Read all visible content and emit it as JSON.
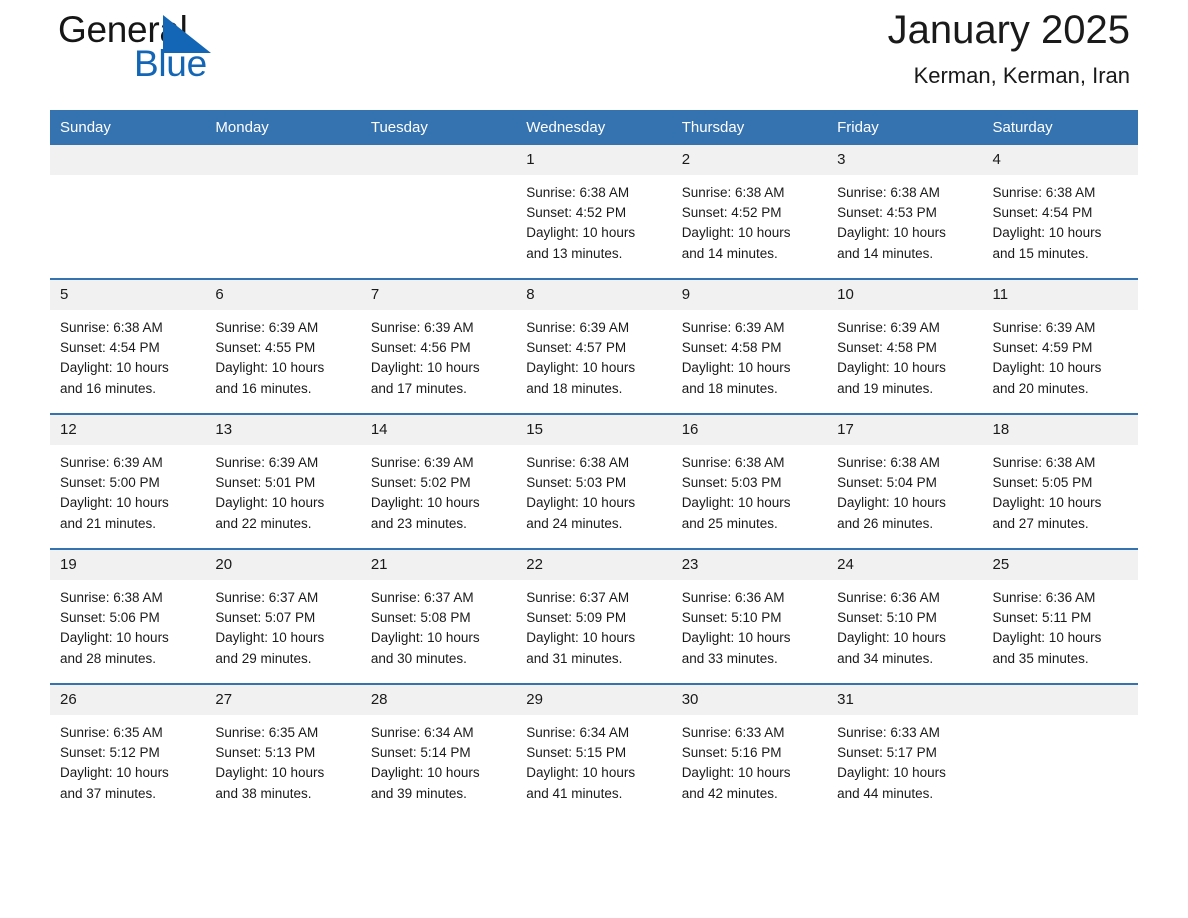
{
  "brand": {
    "word1": "General",
    "word2": "Blue",
    "triangle_color": "#1266b5",
    "word1_color": "#161616",
    "word2_color": "#1266b5"
  },
  "header": {
    "title": "January 2025",
    "subtitle": "Kerman, Kerman, Iran"
  },
  "colors": {
    "header_blue": "#3572b0",
    "row_divider_blue": "#3572b0",
    "daynum_band": "#f1f1f1",
    "text": "#1a1a1a"
  },
  "weekday_headers": [
    "Sunday",
    "Monday",
    "Tuesday",
    "Wednesday",
    "Thursday",
    "Friday",
    "Saturday"
  ],
  "weeks": [
    [
      {
        "day": "",
        "sunrise": "",
        "sunset": "",
        "daylight1": "",
        "daylight2": ""
      },
      {
        "day": "",
        "sunrise": "",
        "sunset": "",
        "daylight1": "",
        "daylight2": ""
      },
      {
        "day": "",
        "sunrise": "",
        "sunset": "",
        "daylight1": "",
        "daylight2": ""
      },
      {
        "day": "1",
        "sunrise": "Sunrise: 6:38 AM",
        "sunset": "Sunset: 4:52 PM",
        "daylight1": "Daylight: 10 hours",
        "daylight2": "and 13 minutes."
      },
      {
        "day": "2",
        "sunrise": "Sunrise: 6:38 AM",
        "sunset": "Sunset: 4:52 PM",
        "daylight1": "Daylight: 10 hours",
        "daylight2": "and 14 minutes."
      },
      {
        "day": "3",
        "sunrise": "Sunrise: 6:38 AM",
        "sunset": "Sunset: 4:53 PM",
        "daylight1": "Daylight: 10 hours",
        "daylight2": "and 14 minutes."
      },
      {
        "day": "4",
        "sunrise": "Sunrise: 6:38 AM",
        "sunset": "Sunset: 4:54 PM",
        "daylight1": "Daylight: 10 hours",
        "daylight2": "and 15 minutes."
      }
    ],
    [
      {
        "day": "5",
        "sunrise": "Sunrise: 6:38 AM",
        "sunset": "Sunset: 4:54 PM",
        "daylight1": "Daylight: 10 hours",
        "daylight2": "and 16 minutes."
      },
      {
        "day": "6",
        "sunrise": "Sunrise: 6:39 AM",
        "sunset": "Sunset: 4:55 PM",
        "daylight1": "Daylight: 10 hours",
        "daylight2": "and 16 minutes."
      },
      {
        "day": "7",
        "sunrise": "Sunrise: 6:39 AM",
        "sunset": "Sunset: 4:56 PM",
        "daylight1": "Daylight: 10 hours",
        "daylight2": "and 17 minutes."
      },
      {
        "day": "8",
        "sunrise": "Sunrise: 6:39 AM",
        "sunset": "Sunset: 4:57 PM",
        "daylight1": "Daylight: 10 hours",
        "daylight2": "and 18 minutes."
      },
      {
        "day": "9",
        "sunrise": "Sunrise: 6:39 AM",
        "sunset": "Sunset: 4:58 PM",
        "daylight1": "Daylight: 10 hours",
        "daylight2": "and 18 minutes."
      },
      {
        "day": "10",
        "sunrise": "Sunrise: 6:39 AM",
        "sunset": "Sunset: 4:58 PM",
        "daylight1": "Daylight: 10 hours",
        "daylight2": "and 19 minutes."
      },
      {
        "day": "11",
        "sunrise": "Sunrise: 6:39 AM",
        "sunset": "Sunset: 4:59 PM",
        "daylight1": "Daylight: 10 hours",
        "daylight2": "and 20 minutes."
      }
    ],
    [
      {
        "day": "12",
        "sunrise": "Sunrise: 6:39 AM",
        "sunset": "Sunset: 5:00 PM",
        "daylight1": "Daylight: 10 hours",
        "daylight2": "and 21 minutes."
      },
      {
        "day": "13",
        "sunrise": "Sunrise: 6:39 AM",
        "sunset": "Sunset: 5:01 PM",
        "daylight1": "Daylight: 10 hours",
        "daylight2": "and 22 minutes."
      },
      {
        "day": "14",
        "sunrise": "Sunrise: 6:39 AM",
        "sunset": "Sunset: 5:02 PM",
        "daylight1": "Daylight: 10 hours",
        "daylight2": "and 23 minutes."
      },
      {
        "day": "15",
        "sunrise": "Sunrise: 6:38 AM",
        "sunset": "Sunset: 5:03 PM",
        "daylight1": "Daylight: 10 hours",
        "daylight2": "and 24 minutes."
      },
      {
        "day": "16",
        "sunrise": "Sunrise: 6:38 AM",
        "sunset": "Sunset: 5:03 PM",
        "daylight1": "Daylight: 10 hours",
        "daylight2": "and 25 minutes."
      },
      {
        "day": "17",
        "sunrise": "Sunrise: 6:38 AM",
        "sunset": "Sunset: 5:04 PM",
        "daylight1": "Daylight: 10 hours",
        "daylight2": "and 26 minutes."
      },
      {
        "day": "18",
        "sunrise": "Sunrise: 6:38 AM",
        "sunset": "Sunset: 5:05 PM",
        "daylight1": "Daylight: 10 hours",
        "daylight2": "and 27 minutes."
      }
    ],
    [
      {
        "day": "19",
        "sunrise": "Sunrise: 6:38 AM",
        "sunset": "Sunset: 5:06 PM",
        "daylight1": "Daylight: 10 hours",
        "daylight2": "and 28 minutes."
      },
      {
        "day": "20",
        "sunrise": "Sunrise: 6:37 AM",
        "sunset": "Sunset: 5:07 PM",
        "daylight1": "Daylight: 10 hours",
        "daylight2": "and 29 minutes."
      },
      {
        "day": "21",
        "sunrise": "Sunrise: 6:37 AM",
        "sunset": "Sunset: 5:08 PM",
        "daylight1": "Daylight: 10 hours",
        "daylight2": "and 30 minutes."
      },
      {
        "day": "22",
        "sunrise": "Sunrise: 6:37 AM",
        "sunset": "Sunset: 5:09 PM",
        "daylight1": "Daylight: 10 hours",
        "daylight2": "and 31 minutes."
      },
      {
        "day": "23",
        "sunrise": "Sunrise: 6:36 AM",
        "sunset": "Sunset: 5:10 PM",
        "daylight1": "Daylight: 10 hours",
        "daylight2": "and 33 minutes."
      },
      {
        "day": "24",
        "sunrise": "Sunrise: 6:36 AM",
        "sunset": "Sunset: 5:10 PM",
        "daylight1": "Daylight: 10 hours",
        "daylight2": "and 34 minutes."
      },
      {
        "day": "25",
        "sunrise": "Sunrise: 6:36 AM",
        "sunset": "Sunset: 5:11 PM",
        "daylight1": "Daylight: 10 hours",
        "daylight2": "and 35 minutes."
      }
    ],
    [
      {
        "day": "26",
        "sunrise": "Sunrise: 6:35 AM",
        "sunset": "Sunset: 5:12 PM",
        "daylight1": "Daylight: 10 hours",
        "daylight2": "and 37 minutes."
      },
      {
        "day": "27",
        "sunrise": "Sunrise: 6:35 AM",
        "sunset": "Sunset: 5:13 PM",
        "daylight1": "Daylight: 10 hours",
        "daylight2": "and 38 minutes."
      },
      {
        "day": "28",
        "sunrise": "Sunrise: 6:34 AM",
        "sunset": "Sunset: 5:14 PM",
        "daylight1": "Daylight: 10 hours",
        "daylight2": "and 39 minutes."
      },
      {
        "day": "29",
        "sunrise": "Sunrise: 6:34 AM",
        "sunset": "Sunset: 5:15 PM",
        "daylight1": "Daylight: 10 hours",
        "daylight2": "and 41 minutes."
      },
      {
        "day": "30",
        "sunrise": "Sunrise: 6:33 AM",
        "sunset": "Sunset: 5:16 PM",
        "daylight1": "Daylight: 10 hours",
        "daylight2": "and 42 minutes."
      },
      {
        "day": "31",
        "sunrise": "Sunrise: 6:33 AM",
        "sunset": "Sunset: 5:17 PM",
        "daylight1": "Daylight: 10 hours",
        "daylight2": "and 44 minutes."
      },
      {
        "day": "",
        "sunrise": "",
        "sunset": "",
        "daylight1": "",
        "daylight2": ""
      }
    ]
  ]
}
